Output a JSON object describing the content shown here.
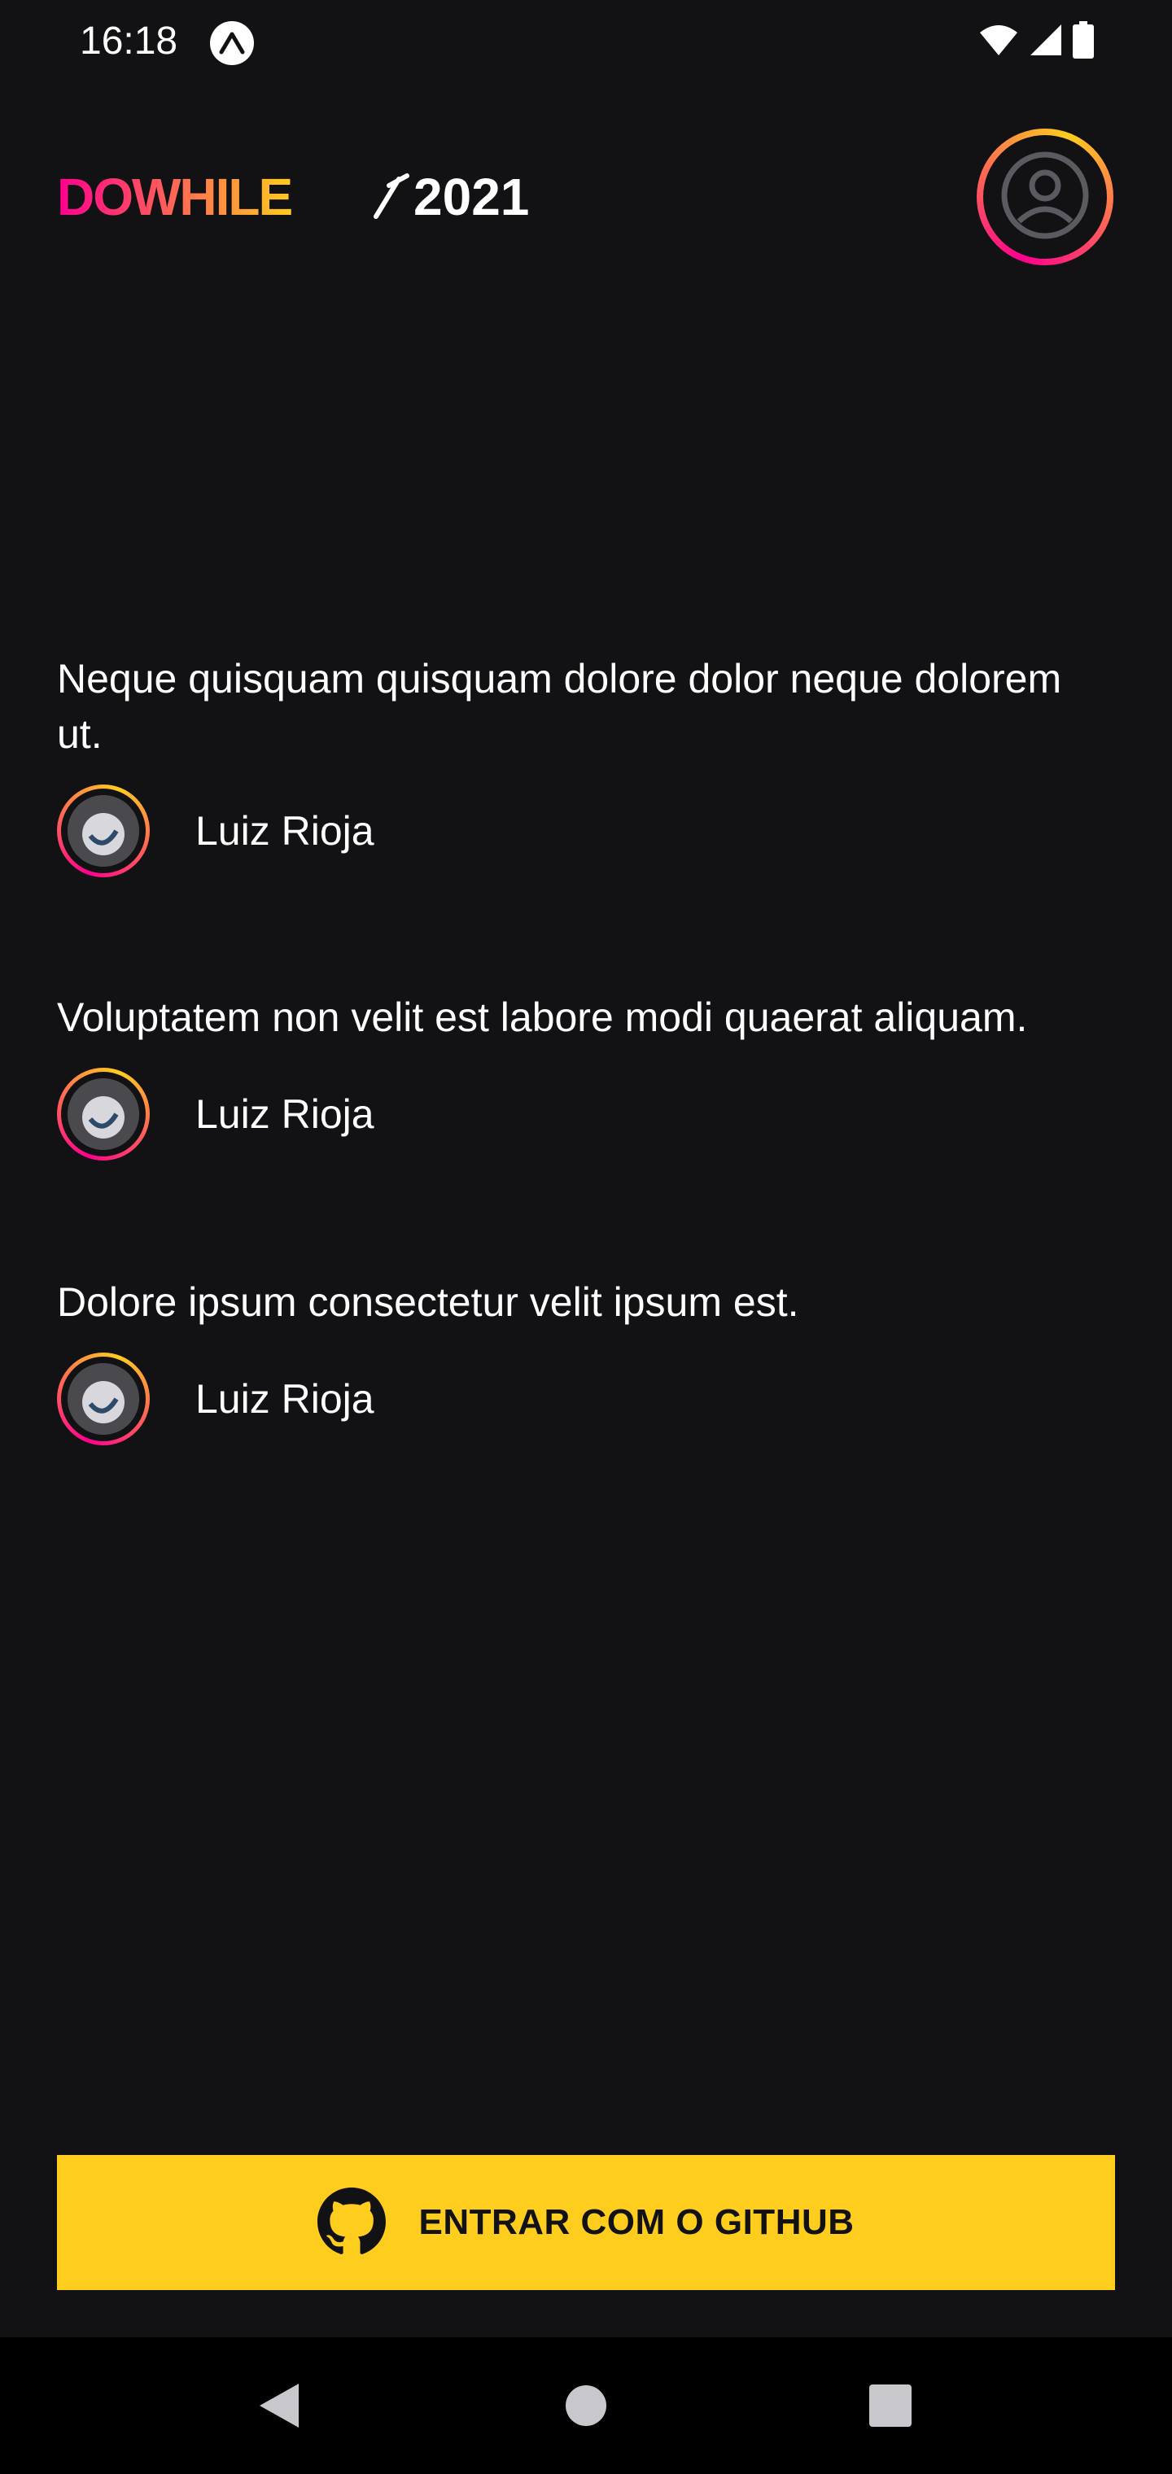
{
  "status_bar": {
    "time": "16:18",
    "app_icon": "expo-icon",
    "wifi_icon": "wifi-icon",
    "signal_icon": "signal-icon",
    "battery_icon": "battery-icon"
  },
  "header": {
    "logo_text": "DOWHILE 2021",
    "logo_word": "DOWHILE",
    "logo_year": "2021",
    "profile_icon": "user-circle-icon"
  },
  "messages": [
    {
      "text": "Neque quisquam quisquam dolore dolor neque dolorem ut.",
      "user": "Luiz Rioja"
    },
    {
      "text": "Voluptatem non velit est labore modi quaerat aliquam.",
      "user": "Luiz Rioja"
    },
    {
      "text": "Dolore ipsum consectetur velit ipsum est.",
      "user": "Luiz Rioja"
    }
  ],
  "sign_in": {
    "label": "ENTRAR COM O GITHUB",
    "icon": "github-icon"
  },
  "colors": {
    "background": "#121214",
    "accent_pink": "#ff008e",
    "accent_yellow": "#ffcd1e",
    "text": "#ffffff"
  },
  "nav": {
    "back_icon": "back-triangle-icon",
    "home_icon": "home-circle-icon",
    "recents_icon": "recents-square-icon"
  }
}
